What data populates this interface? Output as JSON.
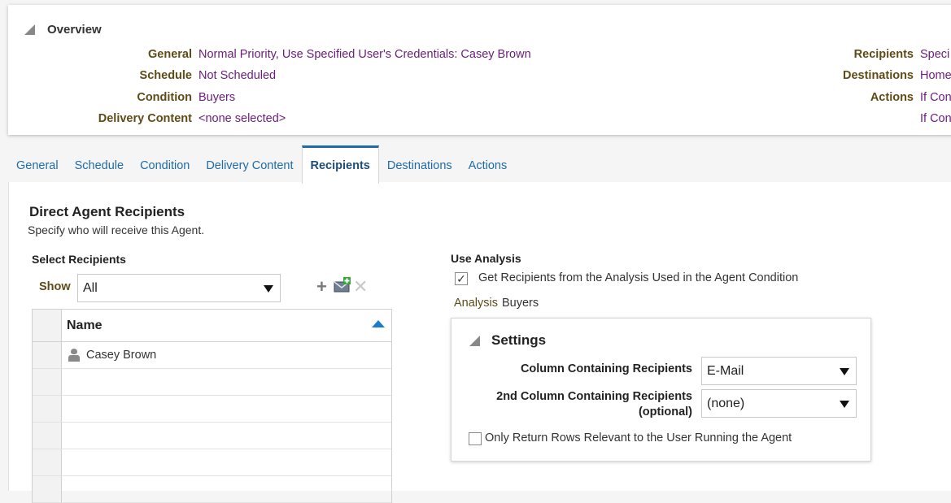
{
  "overview": {
    "title": "Overview",
    "left_rows": [
      {
        "label": "General",
        "value": "Normal Priority, Use Specified User's Credentials: Casey Brown"
      },
      {
        "label": "Schedule",
        "value": "Not Scheduled"
      },
      {
        "label": "Condition",
        "value": "Buyers"
      },
      {
        "label": "Delivery Content",
        "value": "<none selected>"
      }
    ],
    "right_rows": [
      {
        "label": "Recipients",
        "value": "Speci"
      },
      {
        "label": "Destinations",
        "value": "Home"
      },
      {
        "label": "Actions",
        "value": "If Con"
      },
      {
        "label": "",
        "value": "If Con"
      }
    ]
  },
  "tabs": [
    {
      "label": "General",
      "active": false
    },
    {
      "label": "Schedule",
      "active": false
    },
    {
      "label": "Condition",
      "active": false
    },
    {
      "label": "Delivery Content",
      "active": false
    },
    {
      "label": "Recipients",
      "active": true
    },
    {
      "label": "Destinations",
      "active": false
    },
    {
      "label": "Actions",
      "active": false
    }
  ],
  "recipients": {
    "title": "Direct Agent Recipients",
    "description": "Specify who will receive this Agent.",
    "select_title": "Select Recipients",
    "show_label": "Show",
    "show_value": "All",
    "toolbar_icons": [
      "add-icon",
      "add-email-icon",
      "delete-icon"
    ],
    "table": {
      "header": "Name",
      "rows": [
        "Casey Brown",
        "",
        "",
        "",
        "",
        ""
      ]
    }
  },
  "use_analysis": {
    "title": "Use Analysis",
    "checkbox_label": "Get Recipients from the Analysis Used in the Agent Condition",
    "checked": true,
    "analysis_label": "Analysis",
    "analysis_value": "Buyers"
  },
  "settings": {
    "title": "Settings",
    "column_label": "Column Containing Recipients",
    "column_value": "E-Mail",
    "second_label_line1": "2nd Column Containing Recipients",
    "second_label_line2": "(optional)",
    "second_value": "(none)",
    "only_relevant_label": "Only Return Rows Relevant to the User Running the Agent",
    "only_relevant_checked": false
  },
  "colors": {
    "label_brown": "#5f4b16",
    "value_purple": "#6b1c7c",
    "link_blue": "#1f6ba8",
    "sort_blue": "#1b7bd1"
  }
}
